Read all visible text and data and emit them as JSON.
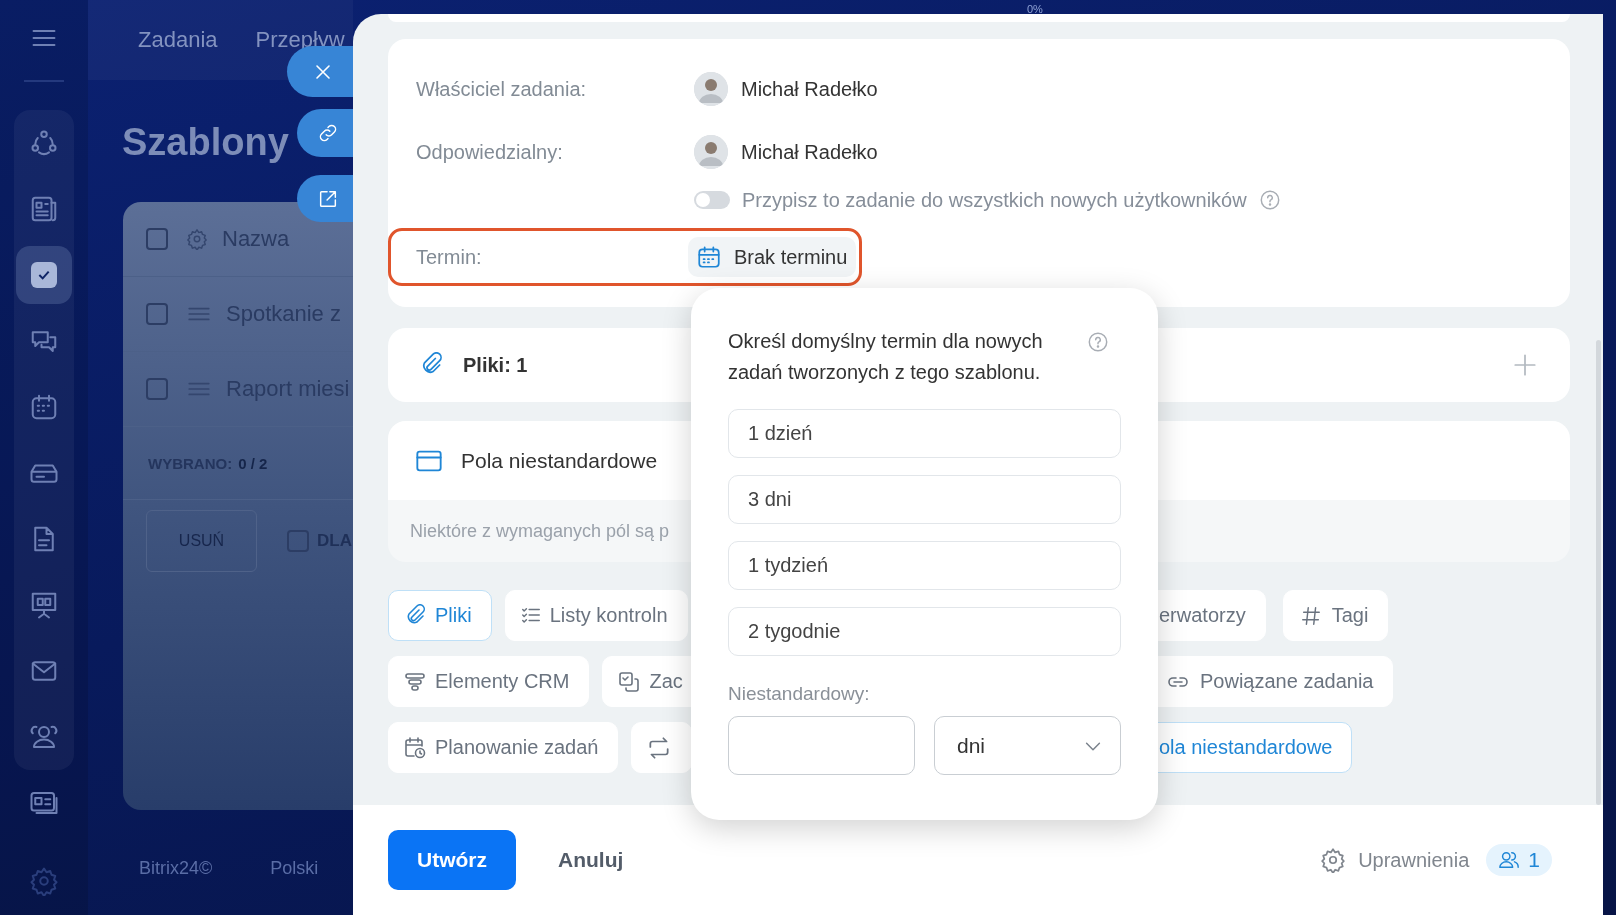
{
  "app": {
    "sidebar": {
      "items": [
        {
          "selected": false
        },
        {
          "selected": false
        },
        {
          "selected": true
        },
        {
          "selected": false
        },
        {
          "selected": false
        },
        {
          "selected": false
        },
        {
          "selected": false
        },
        {
          "selected": false
        },
        {
          "selected": false
        },
        {
          "selected": false
        },
        {
          "selected": false
        }
      ]
    },
    "top_nav": [
      "Zadania",
      "Przepływ"
    ],
    "progress": "0%",
    "heading": "Szablony",
    "table": {
      "all_checked": false,
      "columns": [
        "Nazwa"
      ],
      "rows": [
        {
          "name": "Spotkanie z",
          "checked": false
        },
        {
          "name": "Raport miesi",
          "checked": false
        }
      ],
      "selected_label": "WYBRANO:",
      "selected_count": "0 / 2",
      "delete_button": "USUŃ",
      "for_all": {
        "label": "DLA",
        "checked": false
      }
    },
    "footer": [
      "Bitrix24©",
      "Polski"
    ]
  },
  "panel": {
    "fields": [
      {
        "kind": "user",
        "label": "Właściciel zadania:",
        "value": "Michał Radełko"
      },
      {
        "kind": "user",
        "label": "Odpowiedzialny:",
        "value": "Michał Radełko"
      },
      {
        "kind": "toggle",
        "on": false,
        "label": "Przypisz to zadanie do wszystkich nowych użytkowników"
      },
      {
        "kind": "deadline",
        "label": "Termin:",
        "value": "Brak terminu",
        "highlighted": true
      }
    ],
    "files": {
      "label": "Pliki: 1"
    },
    "custom_fields": {
      "title": "Pola niestandardowe",
      "notice": "Niektóre z wymaganych pól są p"
    },
    "chips": [
      {
        "left": [
          {
            "label": "Pliki",
            "selected": true
          },
          {
            "label": "Listy kontroln",
            "selected": false
          }
        ],
        "right": [
          {
            "label": "erwatorzy",
            "selected": false
          },
          {
            "label": "Tagi",
            "selected": false
          }
        ]
      },
      {
        "left": [
          {
            "label": "Elementy CRM",
            "selected": false
          },
          {
            "label": "Zac",
            "selected": false
          }
        ],
        "right": [
          {
            "label": "Powiązane zadania",
            "selected": false
          }
        ]
      },
      {
        "left": [
          {
            "label": "Planowanie zadań",
            "selected": false
          },
          {
            "selected": false
          }
        ],
        "right": [
          {
            "label": "ola niestandardowe",
            "selected": true
          }
        ]
      }
    ],
    "footer": {
      "create": "Utwórz",
      "cancel": "Anuluj",
      "permissions": "Uprawnienia",
      "members_count": "1"
    }
  },
  "popup": {
    "text": "Określ domyślny termin dla nowych zadań tworzonych z tego szablonu.",
    "options": [
      "1 dzień",
      "3 dni",
      "1 tydzień",
      "2 tygodnie"
    ],
    "custom_label": "Niestandardowy:",
    "unit": "dni"
  }
}
